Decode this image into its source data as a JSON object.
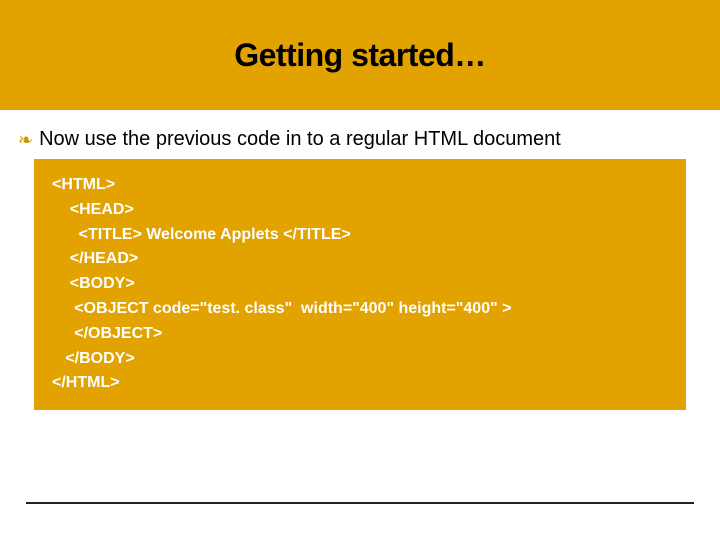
{
  "header": {
    "title": "Getting started…"
  },
  "body": {
    "bullet_text": "Now use the previous code in to a regular  HTML document"
  },
  "code": {
    "lines": [
      "<HTML>",
      "    <HEAD>",
      "      <TITLE> Welcome Applets </TITLE>",
      "    </HEAD>",
      "    <BODY>",
      "     <OBJECT code=\"test. class\"  width=\"400\" height=\"400\" >",
      "     </OBJECT>",
      "   </BODY>",
      "</HTML>"
    ]
  }
}
